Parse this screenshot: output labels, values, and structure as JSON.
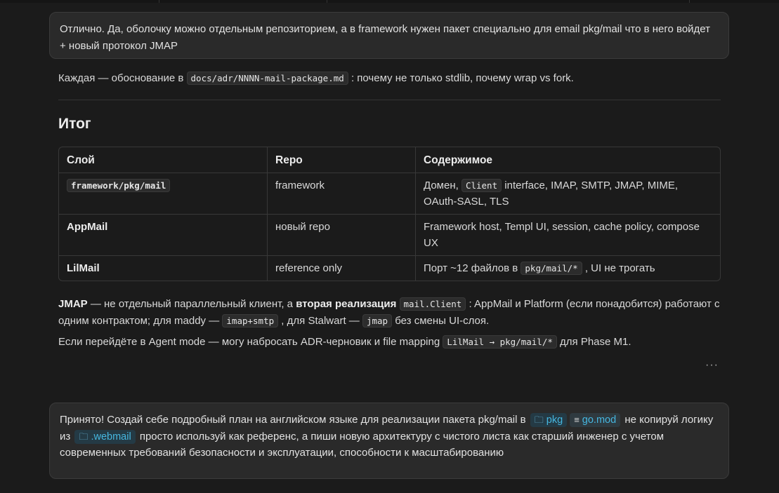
{
  "message_top": {
    "text": "Отлично. Да, оболочку можно отдельным репозиторием, а в framework нужен пакет специально для email pkg/mail что в него войдет + новый протокол JMAP"
  },
  "each_line": {
    "before": "Каждая — обоснование в ",
    "code": "docs/adr/NNNN-mail-package.md",
    "after": " : почему не только stdlib, почему wrap vs fork."
  },
  "summary_heading": "Итог",
  "table": {
    "headers": [
      "Слой",
      "Repo",
      "Содержимое"
    ],
    "rows": [
      {
        "layer": "framework/pkg/mail",
        "repo": "framework",
        "content_before": "Домен, ",
        "content_code": "Client",
        "content_after": " interface, IMAP, SMTP, JMAP, MIME, OAuth-SASL, TLS"
      },
      {
        "layer": "AppMail",
        "repo": "новый repo",
        "content_before": "Framework host, Templ UI, session, cache policy, compose UX",
        "content_code": "",
        "content_after": ""
      },
      {
        "layer": "LilMail",
        "repo": "reference only",
        "content_before": "Порт ~12 файлов в ",
        "content_code": "pkg/mail/*",
        "content_after": " , UI не трогать"
      }
    ]
  },
  "jmap_para": {
    "b1": "JMAP",
    "t1": " — не отдельный параллельный клиент, а ",
    "b2": "вторая реализация",
    "code1": "mail.Client",
    "t2": " : AppMail и Platform (если понадобится) работают с одним контрактом; для maddy — ",
    "code2": "imap+smtp",
    "t3": " , для Stalwart — ",
    "code3": "jmap",
    "t4": " без смены UI-слоя."
  },
  "agent_para": {
    "before": "Если перейдёте в Agent mode — могу набросать ADR-черновик и file mapping ",
    "code": "LilMail → pkg/mail/*",
    "after": " для Phase M1."
  },
  "more_actions": "···",
  "message_bottom": {
    "t1": "Принято! Создай себе подробный план на английском языке для реализации пакета pkg/mail в ",
    "chip_pkg": "pkg",
    "chip_gomod": "go.mod",
    "t2": "  не копируй логику из ",
    "chip_webmail": ".webmail",
    "t3": "  просто используй как референс, а пиши новую архитектуру с чистого листа как старший инженер с учетом современных требований безопасности и эксплуатации, способности к масштабированию"
  },
  "icons": {
    "folder": "folder-icon",
    "file": "file-lines-icon",
    "ellipsis": "ellipsis-icon"
  },
  "colors": {
    "background": "#1b1b1b",
    "bubble": "#2a2a2a",
    "chip_text": "#46b7e0",
    "chip_bg": "#243a45"
  }
}
